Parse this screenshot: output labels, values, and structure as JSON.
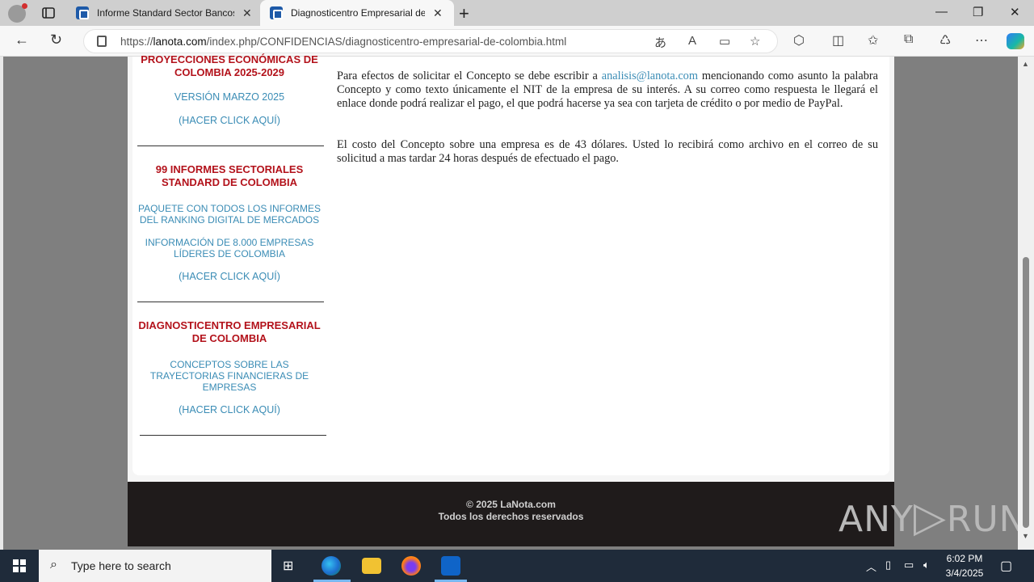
{
  "browser": {
    "tabs": [
      {
        "title": "Informe Standard Sector Bancos",
        "close": "✕"
      },
      {
        "title": "Diagnosticentro Empresarial de C",
        "close": "✕"
      }
    ],
    "new_tab": "+",
    "window_controls": {
      "minimize": "—",
      "restore": "❐",
      "close": "✕"
    },
    "url_prefix": "https://",
    "url_host": "lanota.com",
    "url_path": "/index.php/CONFIDENCIAS/diagnosticentro-empresarial-de-colombia.html",
    "nav": {
      "back": "←",
      "reload": "↻"
    },
    "toolbar_icons": [
      "translate-icon",
      "read-aloud-icon",
      "immersive-reader-icon",
      "favorite-icon",
      "extensions-icon",
      "split-screen-icon",
      "favorites-icon",
      "collections-icon",
      "performance-icon",
      "more-icon",
      "copilot-icon"
    ]
  },
  "sidebar": {
    "block1": {
      "title": "PROYECCIONES ECONÓMICAS DE COLOMBIA 2025-2029",
      "subtitle": "VERSIÓN MARZO 2025",
      "link": "(HACER CLICK AQUÍ)"
    },
    "block2": {
      "title": "99 INFORMES SECTORIALES STANDARD DE COLOMBIA",
      "desc1": "PAQUETE CON TODOS LOS INFORMES DEL RANKING DIGITAL DE MERCADOS",
      "desc2": "INFORMACIÓN DE 8.000 EMPRESAS LÍDERES DE COLOMBIA",
      "link": "(HACER CLICK AQUÍ)"
    },
    "block3": {
      "title": "DIAGNOSTICENTRO EMPRESARIAL DE COLOMBIA",
      "desc": "CONCEPTOS SOBRE LAS TRAYECTORIAS FINANCIERAS DE EMPRESAS",
      "link": "(HACER CLICK AQUÍ)"
    }
  },
  "main": {
    "p1_before": "Para efectos de solicitar el Concepto se debe escribir a ",
    "p1_email": "analisis@lanota.com",
    "p1_after": " mencionando como asunto la palabra Concepto y como texto únicamente el NIT de la empresa de su interés. A su correo como respuesta le llegará el enlace donde podrá realizar el pago, el que podrá hacerse ya sea con tarjeta de crédito o por medio de PayPal.",
    "p2": "El costo del Concepto sobre una empresa es de 43 dólares. Usted lo recibirá como archivo en el correo de su solicitud a mas tardar 24 horas después de efectuado el pago."
  },
  "footer": {
    "copyright": "© 2025 LaNota.com",
    "rights": "Todos los derechos reservados"
  },
  "watermark": {
    "left": "ANY",
    "right": "RUN"
  },
  "taskbar": {
    "search_placeholder": "Type here to search",
    "time": "6:02 PM",
    "date": "3/4/2025"
  }
}
